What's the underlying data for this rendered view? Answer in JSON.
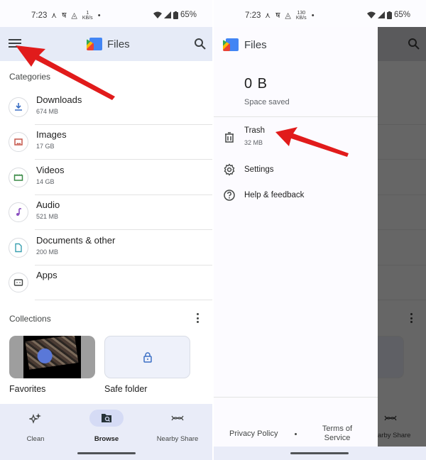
{
  "left": {
    "status_bar": {
      "time": "7:23",
      "net_speed": "1",
      "net_unit": "KB/s",
      "battery": "65%"
    },
    "app_bar": {
      "title": "Files",
      "menu_icon": "hamburger-menu-icon",
      "search_icon": "search-icon"
    },
    "categories": {
      "label": "Categories",
      "items": [
        {
          "name": "Downloads",
          "size": "674 MB",
          "icon": "download-icon",
          "color": "#3b6fc4"
        },
        {
          "name": "Images",
          "size": "17 GB",
          "icon": "image-icon",
          "color": "#c5564a"
        },
        {
          "name": "Videos",
          "size": "14 GB",
          "icon": "video-icon",
          "color": "#3a8a47"
        },
        {
          "name": "Audio",
          "size": "521 MB",
          "icon": "music-note-icon",
          "color": "#8a4fc0"
        },
        {
          "name": "Documents & other",
          "size": "200 MB",
          "icon": "document-icon",
          "color": "#3aa0b0"
        },
        {
          "name": "Apps",
          "size": "",
          "icon": "android-icon",
          "color": "#444746"
        }
      ]
    },
    "collections": {
      "label": "Collections",
      "items": [
        {
          "name": "Favorites"
        },
        {
          "name": "Safe folder",
          "icon": "lock-icon",
          "color": "#3b6fc4"
        }
      ]
    },
    "bottom_nav": {
      "items": [
        {
          "label": "Clean",
          "icon": "sparkle-icon",
          "active": false
        },
        {
          "label": "Browse",
          "icon": "browse-folder-icon",
          "active": true
        },
        {
          "label": "Nearby Share",
          "icon": "nearby-share-icon",
          "active": false
        }
      ]
    }
  },
  "right": {
    "status_bar": {
      "time": "7:23",
      "net_speed": "130",
      "net_unit": "KB/s",
      "battery": "65%"
    },
    "drawer": {
      "title": "Files",
      "space_saved_value": "0 B",
      "space_saved_label": "Space saved",
      "items": [
        {
          "name": "Trash",
          "sub": "32 MB",
          "icon": "trash-icon"
        },
        {
          "name": "Settings",
          "sub": "",
          "icon": "gear-icon"
        },
        {
          "name": "Help & feedback",
          "sub": "",
          "icon": "help-icon"
        }
      ],
      "footer": {
        "privacy": "Privacy Policy",
        "terms": "Terms of Service"
      }
    },
    "scrim": {
      "nav_label_partial": "arby Share"
    }
  },
  "annotations": {
    "arrow_color": "#e11b1b"
  }
}
